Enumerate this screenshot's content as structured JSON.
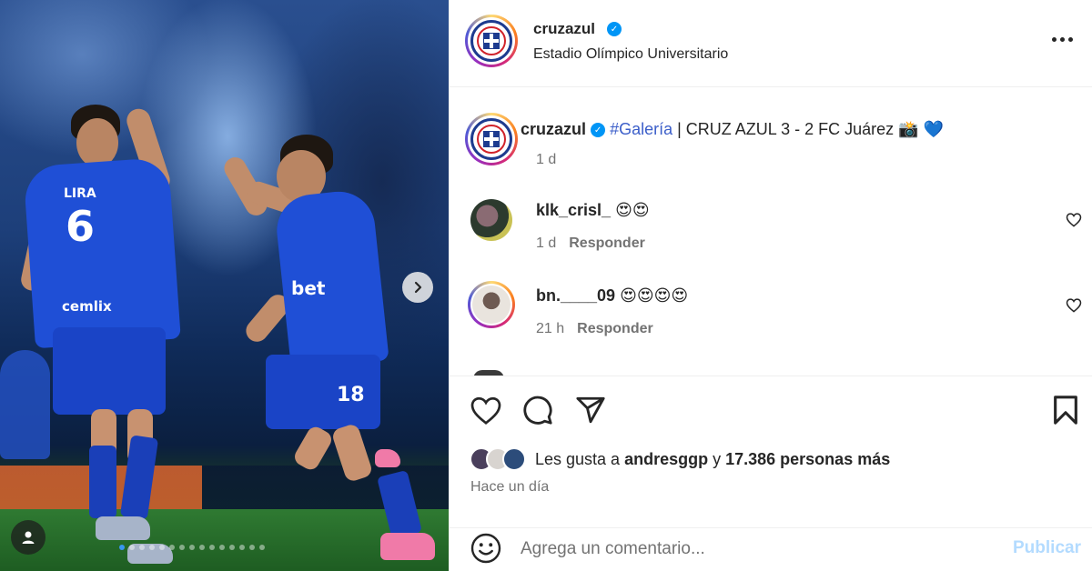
{
  "post": {
    "username": "cruzazul",
    "location": "Estadio Olímpico Universitario",
    "media": {
      "player_left_name": "LIRA",
      "player_left_number": "6",
      "player_left_sponsor": "cemlix",
      "player_right_number": "18",
      "player_right_sponsor": "bet",
      "carousel_count": 15,
      "carousel_active_index": 0
    }
  },
  "caption": {
    "username": "cruzazul",
    "hashtag": "#Galería",
    "text": " | CRUZ AZUL 3 - 2 FC Juárez 📸 💙",
    "time": "1 d"
  },
  "comments": [
    {
      "username": "klk_crisl_",
      "text": "😍😍",
      "time": "1 d",
      "reply_label": "Responder"
    },
    {
      "username": "bn.____09",
      "text": "😍😍😍😍",
      "time": "21 h",
      "reply_label": "Responder"
    }
  ],
  "likes": {
    "prefix": "Les gusta a ",
    "user": "andresggp",
    "connector": " y ",
    "others": "17.386 personas más"
  },
  "posted_ago": "Hace un día",
  "comment_box": {
    "placeholder": "Agrega un comentario...",
    "publish_label": "Publicar"
  },
  "icons": {
    "verified": "verified-badge-icon",
    "more": "more-options-icon",
    "next": "chevron-right-icon",
    "profile_tag": "user-tag-icon",
    "like": "heart-icon",
    "comment": "comment-bubble-icon",
    "share": "paper-plane-icon",
    "save": "bookmark-icon",
    "emoji": "emoji-smile-icon"
  },
  "colors": {
    "verified_blue": "#0095f6",
    "hashtag_blue": "#3b5ec9",
    "publish_disabled": "#b3dbff",
    "carousel_active": "#3897f0"
  }
}
